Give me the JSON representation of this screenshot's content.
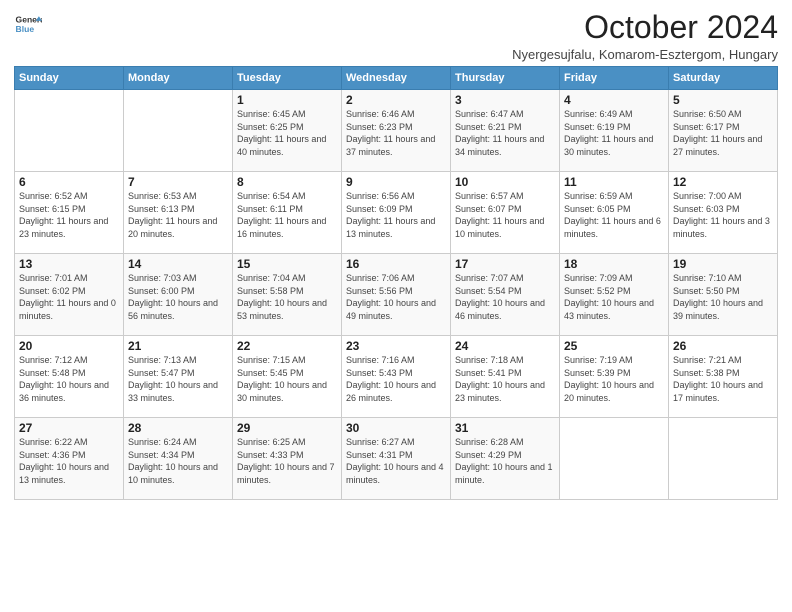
{
  "logo": {
    "line1": "General",
    "line2": "Blue"
  },
  "title": "October 2024",
  "location": "Nyergesujfalu, Komarom-Esztergom, Hungary",
  "days_of_week": [
    "Sunday",
    "Monday",
    "Tuesday",
    "Wednesday",
    "Thursday",
    "Friday",
    "Saturday"
  ],
  "weeks": [
    [
      {
        "day": "",
        "sunrise": "",
        "sunset": "",
        "daylight": ""
      },
      {
        "day": "",
        "sunrise": "",
        "sunset": "",
        "daylight": ""
      },
      {
        "day": "1",
        "sunrise": "Sunrise: 6:45 AM",
        "sunset": "Sunset: 6:25 PM",
        "daylight": "Daylight: 11 hours and 40 minutes."
      },
      {
        "day": "2",
        "sunrise": "Sunrise: 6:46 AM",
        "sunset": "Sunset: 6:23 PM",
        "daylight": "Daylight: 11 hours and 37 minutes."
      },
      {
        "day": "3",
        "sunrise": "Sunrise: 6:47 AM",
        "sunset": "Sunset: 6:21 PM",
        "daylight": "Daylight: 11 hours and 34 minutes."
      },
      {
        "day": "4",
        "sunrise": "Sunrise: 6:49 AM",
        "sunset": "Sunset: 6:19 PM",
        "daylight": "Daylight: 11 hours and 30 minutes."
      },
      {
        "day": "5",
        "sunrise": "Sunrise: 6:50 AM",
        "sunset": "Sunset: 6:17 PM",
        "daylight": "Daylight: 11 hours and 27 minutes."
      }
    ],
    [
      {
        "day": "6",
        "sunrise": "Sunrise: 6:52 AM",
        "sunset": "Sunset: 6:15 PM",
        "daylight": "Daylight: 11 hours and 23 minutes."
      },
      {
        "day": "7",
        "sunrise": "Sunrise: 6:53 AM",
        "sunset": "Sunset: 6:13 PM",
        "daylight": "Daylight: 11 hours and 20 minutes."
      },
      {
        "day": "8",
        "sunrise": "Sunrise: 6:54 AM",
        "sunset": "Sunset: 6:11 PM",
        "daylight": "Daylight: 11 hours and 16 minutes."
      },
      {
        "day": "9",
        "sunrise": "Sunrise: 6:56 AM",
        "sunset": "Sunset: 6:09 PM",
        "daylight": "Daylight: 11 hours and 13 minutes."
      },
      {
        "day": "10",
        "sunrise": "Sunrise: 6:57 AM",
        "sunset": "Sunset: 6:07 PM",
        "daylight": "Daylight: 11 hours and 10 minutes."
      },
      {
        "day": "11",
        "sunrise": "Sunrise: 6:59 AM",
        "sunset": "Sunset: 6:05 PM",
        "daylight": "Daylight: 11 hours and 6 minutes."
      },
      {
        "day": "12",
        "sunrise": "Sunrise: 7:00 AM",
        "sunset": "Sunset: 6:03 PM",
        "daylight": "Daylight: 11 hours and 3 minutes."
      }
    ],
    [
      {
        "day": "13",
        "sunrise": "Sunrise: 7:01 AM",
        "sunset": "Sunset: 6:02 PM",
        "daylight": "Daylight: 11 hours and 0 minutes."
      },
      {
        "day": "14",
        "sunrise": "Sunrise: 7:03 AM",
        "sunset": "Sunset: 6:00 PM",
        "daylight": "Daylight: 10 hours and 56 minutes."
      },
      {
        "day": "15",
        "sunrise": "Sunrise: 7:04 AM",
        "sunset": "Sunset: 5:58 PM",
        "daylight": "Daylight: 10 hours and 53 minutes."
      },
      {
        "day": "16",
        "sunrise": "Sunrise: 7:06 AM",
        "sunset": "Sunset: 5:56 PM",
        "daylight": "Daylight: 10 hours and 49 minutes."
      },
      {
        "day": "17",
        "sunrise": "Sunrise: 7:07 AM",
        "sunset": "Sunset: 5:54 PM",
        "daylight": "Daylight: 10 hours and 46 minutes."
      },
      {
        "day": "18",
        "sunrise": "Sunrise: 7:09 AM",
        "sunset": "Sunset: 5:52 PM",
        "daylight": "Daylight: 10 hours and 43 minutes."
      },
      {
        "day": "19",
        "sunrise": "Sunrise: 7:10 AM",
        "sunset": "Sunset: 5:50 PM",
        "daylight": "Daylight: 10 hours and 39 minutes."
      }
    ],
    [
      {
        "day": "20",
        "sunrise": "Sunrise: 7:12 AM",
        "sunset": "Sunset: 5:48 PM",
        "daylight": "Daylight: 10 hours and 36 minutes."
      },
      {
        "day": "21",
        "sunrise": "Sunrise: 7:13 AM",
        "sunset": "Sunset: 5:47 PM",
        "daylight": "Daylight: 10 hours and 33 minutes."
      },
      {
        "day": "22",
        "sunrise": "Sunrise: 7:15 AM",
        "sunset": "Sunset: 5:45 PM",
        "daylight": "Daylight: 10 hours and 30 minutes."
      },
      {
        "day": "23",
        "sunrise": "Sunrise: 7:16 AM",
        "sunset": "Sunset: 5:43 PM",
        "daylight": "Daylight: 10 hours and 26 minutes."
      },
      {
        "day": "24",
        "sunrise": "Sunrise: 7:18 AM",
        "sunset": "Sunset: 5:41 PM",
        "daylight": "Daylight: 10 hours and 23 minutes."
      },
      {
        "day": "25",
        "sunrise": "Sunrise: 7:19 AM",
        "sunset": "Sunset: 5:39 PM",
        "daylight": "Daylight: 10 hours and 20 minutes."
      },
      {
        "day": "26",
        "sunrise": "Sunrise: 7:21 AM",
        "sunset": "Sunset: 5:38 PM",
        "daylight": "Daylight: 10 hours and 17 minutes."
      }
    ],
    [
      {
        "day": "27",
        "sunrise": "Sunrise: 6:22 AM",
        "sunset": "Sunset: 4:36 PM",
        "daylight": "Daylight: 10 hours and 13 minutes."
      },
      {
        "day": "28",
        "sunrise": "Sunrise: 6:24 AM",
        "sunset": "Sunset: 4:34 PM",
        "daylight": "Daylight: 10 hours and 10 minutes."
      },
      {
        "day": "29",
        "sunrise": "Sunrise: 6:25 AM",
        "sunset": "Sunset: 4:33 PM",
        "daylight": "Daylight: 10 hours and 7 minutes."
      },
      {
        "day": "30",
        "sunrise": "Sunrise: 6:27 AM",
        "sunset": "Sunset: 4:31 PM",
        "daylight": "Daylight: 10 hours and 4 minutes."
      },
      {
        "day": "31",
        "sunrise": "Sunrise: 6:28 AM",
        "sunset": "Sunset: 4:29 PM",
        "daylight": "Daylight: 10 hours and 1 minute."
      },
      {
        "day": "",
        "sunrise": "",
        "sunset": "",
        "daylight": ""
      },
      {
        "day": "",
        "sunrise": "",
        "sunset": "",
        "daylight": ""
      }
    ]
  ]
}
